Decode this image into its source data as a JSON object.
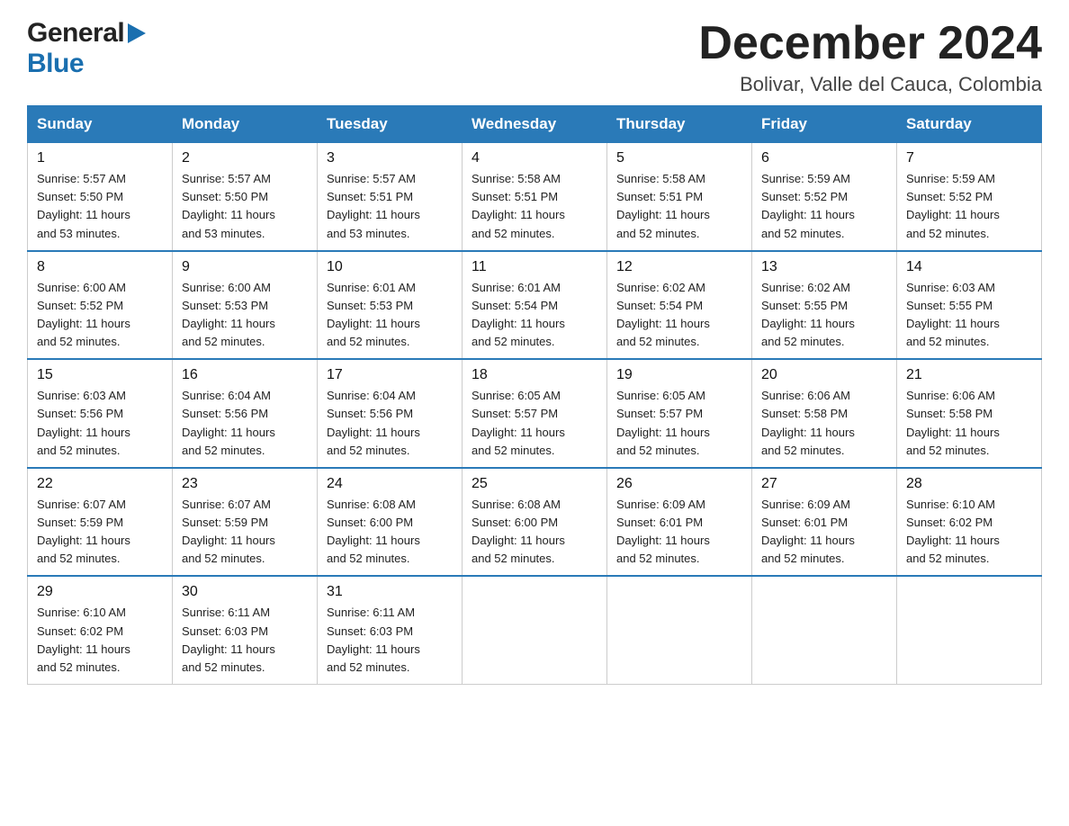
{
  "logo": {
    "general": "General",
    "blue": "Blue",
    "triangle_unicode": "▶"
  },
  "title": "December 2024",
  "location": "Bolivar, Valle del Cauca, Colombia",
  "days_of_week": [
    "Sunday",
    "Monday",
    "Tuesday",
    "Wednesday",
    "Thursday",
    "Friday",
    "Saturday"
  ],
  "weeks": [
    [
      {
        "num": "1",
        "sunrise": "5:57 AM",
        "sunset": "5:50 PM",
        "daylight": "11 hours and 53 minutes."
      },
      {
        "num": "2",
        "sunrise": "5:57 AM",
        "sunset": "5:50 PM",
        "daylight": "11 hours and 53 minutes."
      },
      {
        "num": "3",
        "sunrise": "5:57 AM",
        "sunset": "5:51 PM",
        "daylight": "11 hours and 53 minutes."
      },
      {
        "num": "4",
        "sunrise": "5:58 AM",
        "sunset": "5:51 PM",
        "daylight": "11 hours and 52 minutes."
      },
      {
        "num": "5",
        "sunrise": "5:58 AM",
        "sunset": "5:51 PM",
        "daylight": "11 hours and 52 minutes."
      },
      {
        "num": "6",
        "sunrise": "5:59 AM",
        "sunset": "5:52 PM",
        "daylight": "11 hours and 52 minutes."
      },
      {
        "num": "7",
        "sunrise": "5:59 AM",
        "sunset": "5:52 PM",
        "daylight": "11 hours and 52 minutes."
      }
    ],
    [
      {
        "num": "8",
        "sunrise": "6:00 AM",
        "sunset": "5:52 PM",
        "daylight": "11 hours and 52 minutes."
      },
      {
        "num": "9",
        "sunrise": "6:00 AM",
        "sunset": "5:53 PM",
        "daylight": "11 hours and 52 minutes."
      },
      {
        "num": "10",
        "sunrise": "6:01 AM",
        "sunset": "5:53 PM",
        "daylight": "11 hours and 52 minutes."
      },
      {
        "num": "11",
        "sunrise": "6:01 AM",
        "sunset": "5:54 PM",
        "daylight": "11 hours and 52 minutes."
      },
      {
        "num": "12",
        "sunrise": "6:02 AM",
        "sunset": "5:54 PM",
        "daylight": "11 hours and 52 minutes."
      },
      {
        "num": "13",
        "sunrise": "6:02 AM",
        "sunset": "5:55 PM",
        "daylight": "11 hours and 52 minutes."
      },
      {
        "num": "14",
        "sunrise": "6:03 AM",
        "sunset": "5:55 PM",
        "daylight": "11 hours and 52 minutes."
      }
    ],
    [
      {
        "num": "15",
        "sunrise": "6:03 AM",
        "sunset": "5:56 PM",
        "daylight": "11 hours and 52 minutes."
      },
      {
        "num": "16",
        "sunrise": "6:04 AM",
        "sunset": "5:56 PM",
        "daylight": "11 hours and 52 minutes."
      },
      {
        "num": "17",
        "sunrise": "6:04 AM",
        "sunset": "5:56 PM",
        "daylight": "11 hours and 52 minutes."
      },
      {
        "num": "18",
        "sunrise": "6:05 AM",
        "sunset": "5:57 PM",
        "daylight": "11 hours and 52 minutes."
      },
      {
        "num": "19",
        "sunrise": "6:05 AM",
        "sunset": "5:57 PM",
        "daylight": "11 hours and 52 minutes."
      },
      {
        "num": "20",
        "sunrise": "6:06 AM",
        "sunset": "5:58 PM",
        "daylight": "11 hours and 52 minutes."
      },
      {
        "num": "21",
        "sunrise": "6:06 AM",
        "sunset": "5:58 PM",
        "daylight": "11 hours and 52 minutes."
      }
    ],
    [
      {
        "num": "22",
        "sunrise": "6:07 AM",
        "sunset": "5:59 PM",
        "daylight": "11 hours and 52 minutes."
      },
      {
        "num": "23",
        "sunrise": "6:07 AM",
        "sunset": "5:59 PM",
        "daylight": "11 hours and 52 minutes."
      },
      {
        "num": "24",
        "sunrise": "6:08 AM",
        "sunset": "6:00 PM",
        "daylight": "11 hours and 52 minutes."
      },
      {
        "num": "25",
        "sunrise": "6:08 AM",
        "sunset": "6:00 PM",
        "daylight": "11 hours and 52 minutes."
      },
      {
        "num": "26",
        "sunrise": "6:09 AM",
        "sunset": "6:01 PM",
        "daylight": "11 hours and 52 minutes."
      },
      {
        "num": "27",
        "sunrise": "6:09 AM",
        "sunset": "6:01 PM",
        "daylight": "11 hours and 52 minutes."
      },
      {
        "num": "28",
        "sunrise": "6:10 AM",
        "sunset": "6:02 PM",
        "daylight": "11 hours and 52 minutes."
      }
    ],
    [
      {
        "num": "29",
        "sunrise": "6:10 AM",
        "sunset": "6:02 PM",
        "daylight": "11 hours and 52 minutes."
      },
      {
        "num": "30",
        "sunrise": "6:11 AM",
        "sunset": "6:03 PM",
        "daylight": "11 hours and 52 minutes."
      },
      {
        "num": "31",
        "sunrise": "6:11 AM",
        "sunset": "6:03 PM",
        "daylight": "11 hours and 52 minutes."
      },
      null,
      null,
      null,
      null
    ]
  ],
  "labels": {
    "sunrise": "Sunrise:",
    "sunset": "Sunset:",
    "daylight": "Daylight:"
  }
}
